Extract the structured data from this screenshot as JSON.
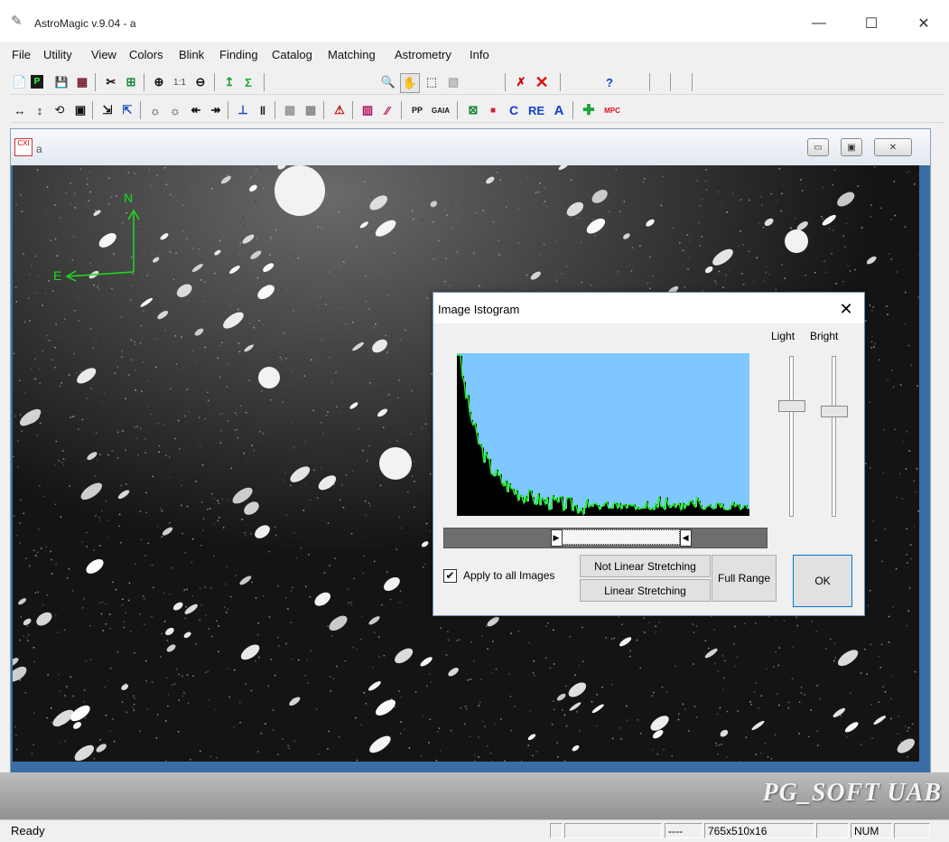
{
  "window": {
    "title": "AstroMagic v.9.04  - a",
    "minimize": "—",
    "maximize": "☐",
    "close": "✕"
  },
  "menu": [
    "File",
    "Utility",
    "View",
    "Colors",
    "Blink",
    "Finding",
    "Catalog",
    "Matching",
    "Astrometry",
    "Info"
  ],
  "toolbar1": [
    "📄",
    "P",
    "💾",
    "▦",
    "✂",
    "⊞",
    "⊕",
    "1:1",
    "⊖",
    "↥",
    "Σ",
    "🔍",
    "✋",
    "⬚",
    "▧",
    "✗",
    "✕",
    "?"
  ],
  "toolbar2": [
    "↔",
    "↕",
    "⟲",
    "▣",
    "⇲",
    "⇱",
    "☼",
    "☼",
    "↞",
    "↠",
    "⊥",
    "‖",
    "▩",
    "▩",
    "⚠",
    "▥",
    "⁄⁄",
    "PP",
    "GAIA",
    "⊠",
    "■",
    "C",
    "RE",
    "A",
    "✚",
    "MPC"
  ],
  "child": {
    "title": "a",
    "minimize": "▭",
    "restore": "▣",
    "close": "✕"
  },
  "compass": {
    "north": "N",
    "east": "E"
  },
  "dialog": {
    "title": "Image Istogram",
    "close": "✕",
    "light_label": "Light",
    "bright_label": "Bright",
    "apply_all_label": "Apply to all Images",
    "apply_all_checked": true,
    "not_linear_label": "Not Linear Stretching",
    "linear_label": "Linear Stretching",
    "full_range_label": "Full Range",
    "ok_label": "OK",
    "light_level": 0.28,
    "bright_level": 0.31,
    "range_low": 0.36,
    "range_high": 0.73
  },
  "histogram": {
    "colors": {
      "background": "#7ec8ff",
      "bars": "#000000",
      "edge": "#22ee22"
    }
  },
  "brand": "PG_SOFT UAB",
  "status": {
    "ready": "Ready",
    "dashes": "----",
    "size": "765x510x16",
    "num": "NUM"
  }
}
